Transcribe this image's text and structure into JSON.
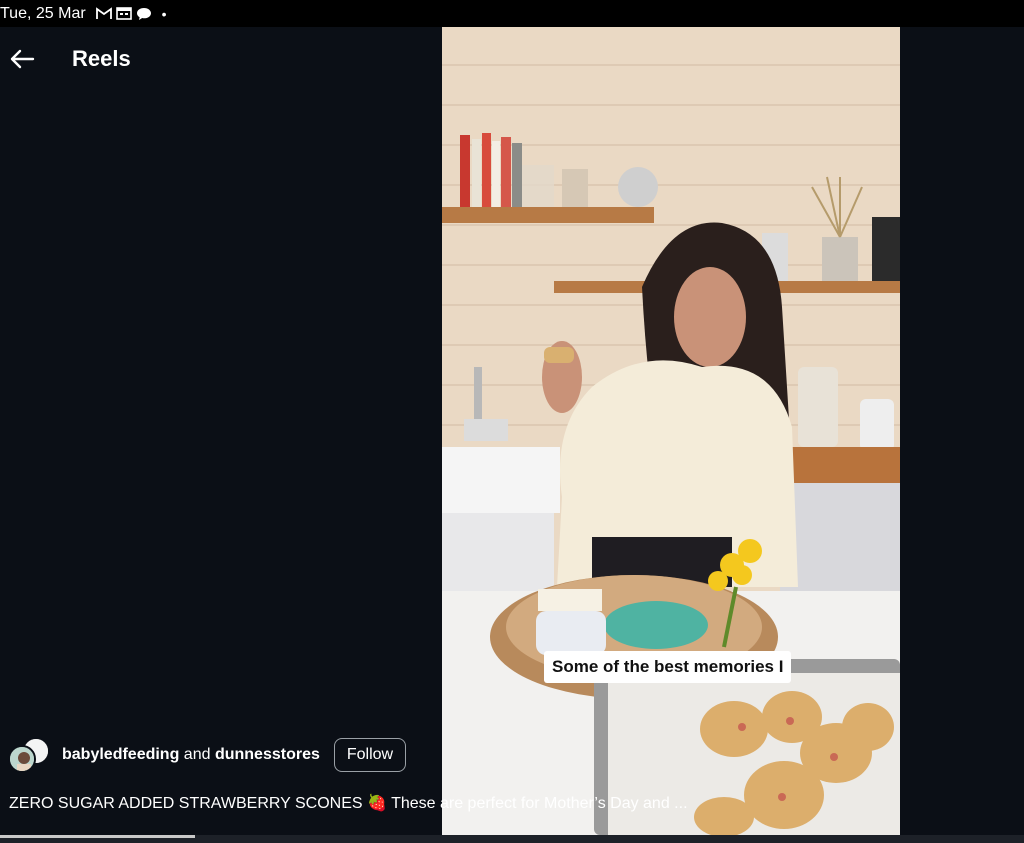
{
  "status_bar": {
    "date": "Tue, 25 Mar",
    "dot": "•"
  },
  "header": {
    "title": "Reels"
  },
  "video": {
    "overlay_caption": "Some of the best memories I"
  },
  "post": {
    "author1": "babyledfeeding",
    "connector": " and ",
    "author2": "dunnesstores",
    "follow_label": "Follow",
    "description": "ZERO SUGAR ADDED STRAWBERRY SCONES 🍓 These are perfect for Mother’s Day and ..."
  },
  "playback": {
    "progress_fraction": 0.19
  }
}
